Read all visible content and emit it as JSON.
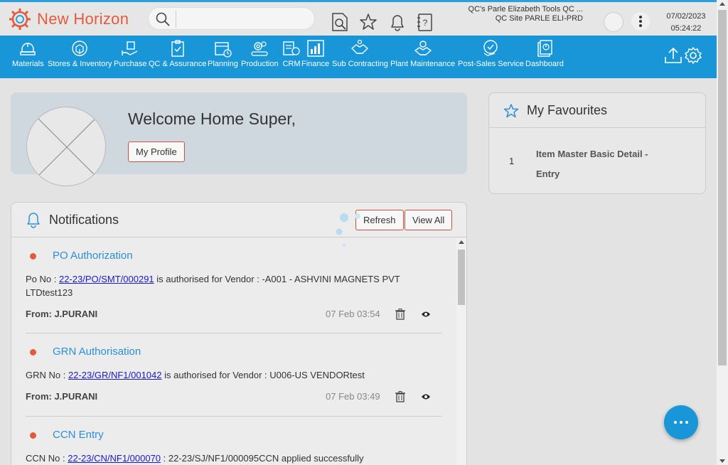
{
  "app": {
    "brand": "New Horizon"
  },
  "search": {
    "placeholder": ""
  },
  "header": {
    "company": "QC's Parle Elizabeth Tools QC ...",
    "site": "QC Site PARLE ELI-PRD",
    "date": "07/02/2023",
    "time": "05:24:22"
  },
  "nav": {
    "items": [
      {
        "label": "Materials",
        "icon": "materials-icon"
      },
      {
        "label": "Stores & Inventory",
        "icon": "stores-icon"
      },
      {
        "label": "Purchase",
        "icon": "purchase-icon"
      },
      {
        "label": "QC & Assurance",
        "icon": "qc-icon"
      },
      {
        "label": "Planning",
        "icon": "planning-icon"
      },
      {
        "label": "Production",
        "icon": "production-icon"
      },
      {
        "label": "CRM",
        "icon": "crm-icon"
      },
      {
        "label": "Finance",
        "icon": "finance-icon"
      },
      {
        "label": "Sub Contracting",
        "icon": "subcontracting-icon"
      },
      {
        "label": "Plant Maintenance",
        "icon": "plant-maintenance-icon"
      },
      {
        "label": "Post-Sales Service",
        "icon": "post-sales-icon"
      },
      {
        "label": "Dashboard",
        "icon": "dashboard-icon"
      }
    ]
  },
  "welcome": {
    "title": "Welcome Home Super,",
    "profile_button": "My Profile"
  },
  "notifications": {
    "title": "Notifications",
    "refresh_label": "Refresh",
    "view_all_label": "View All",
    "items": [
      {
        "title": "PO Authorization",
        "prefix": "Po No : ",
        "link": "22-23/PO/SMT/000291",
        "suffix": " is authorised for Vendor : -A001 - ASHVINI MAGNETS PVT LTDtest123",
        "from": "From: J.PURANI",
        "time": "07 Feb 03:54"
      },
      {
        "title": "GRN Authorisation",
        "prefix": "GRN No : ",
        "link": "22-23/GR/NF1/001042",
        "suffix": " is authorised for Vendor : U006-US VENDORtest",
        "from": "From: J.PURANI",
        "time": "07 Feb 03:49"
      },
      {
        "title": "CCN Entry",
        "prefix": "CCN No : ",
        "link": "22-23/CN/NF1/000070",
        "suffix": " : 22-23/SJ/NF1/000095CCN applied successfully"
      }
    ]
  },
  "favourites": {
    "title": "My Favourites",
    "items": [
      {
        "num": "1",
        "label": "Item Master Basic Detail - Entry"
      }
    ]
  },
  "colors": {
    "brand": "#e55a3c",
    "nav": "#1896d7",
    "link": "#2b8fd6"
  }
}
